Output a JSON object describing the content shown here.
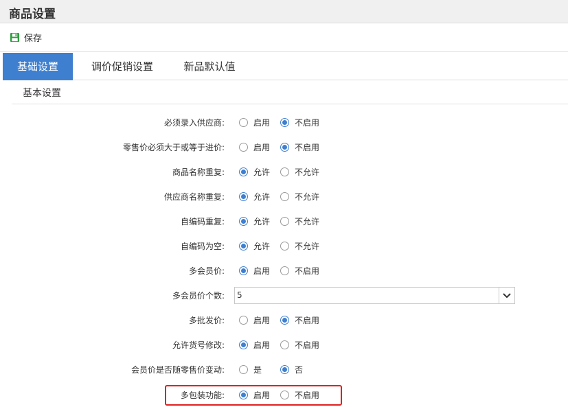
{
  "page": {
    "title": "商品设置"
  },
  "toolbar": {
    "save_label": "保存"
  },
  "tabs": [
    {
      "label": "基础设置",
      "active": true
    },
    {
      "label": "调价促销设置",
      "active": false
    },
    {
      "label": "新品默认值",
      "active": false
    }
  ],
  "section": {
    "title": "基本设置"
  },
  "settings": [
    {
      "label": "必须录入供应商:",
      "options": [
        "启用",
        "不启用"
      ],
      "selected": 1
    },
    {
      "label": "零售价必须大于或等于进价:",
      "options": [
        "启用",
        "不启用"
      ],
      "selected": 1
    },
    {
      "label": "商品名称重复:",
      "options": [
        "允许",
        "不允许"
      ],
      "selected": 0
    },
    {
      "label": "供应商名称重复:",
      "options": [
        "允许",
        "不允许"
      ],
      "selected": 0
    },
    {
      "label": "自编码重复:",
      "options": [
        "允许",
        "不允许"
      ],
      "selected": 0
    },
    {
      "label": "自编码为空:",
      "options": [
        "允许",
        "不允许"
      ],
      "selected": 0
    },
    {
      "label": "多会员价:",
      "options": [
        "启用",
        "不启用"
      ],
      "selected": 0
    },
    {
      "label": "多会员价个数:",
      "select_value": "5"
    },
    {
      "label": "多批发价:",
      "options": [
        "启用",
        "不启用"
      ],
      "selected": 1
    },
    {
      "label": "允许货号修改:",
      "options": [
        "启用",
        "不启用"
      ],
      "selected": 0
    },
    {
      "label": "会员价是否随零售价变动:",
      "options": [
        "是",
        "否"
      ],
      "selected": 1
    },
    {
      "label": "多包装功能:",
      "options": [
        "启用",
        "不启用"
      ],
      "selected": 0
    }
  ],
  "colors": {
    "accent": "#3e7fd0",
    "highlight": "#e02020"
  },
  "icons": {
    "save": "floppy-disk-icon",
    "dropdown": "chevron-down-icon"
  }
}
